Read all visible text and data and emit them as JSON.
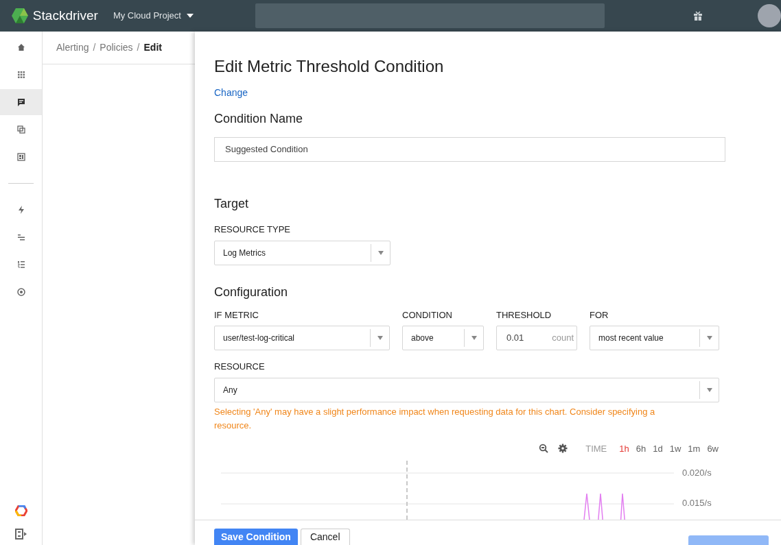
{
  "header": {
    "product": "Stackdriver",
    "project": "My Cloud Project"
  },
  "sidebar": {
    "items": [
      {
        "selected": false
      },
      {
        "selected": false
      },
      {
        "selected": true
      },
      {
        "selected": false
      },
      {
        "selected": false
      },
      {
        "selected": false
      },
      {
        "selected": false
      },
      {
        "selected": false
      },
      {
        "selected": false
      }
    ]
  },
  "breadcrumb": {
    "separator": "/",
    "items": [
      {
        "label": "Alerting",
        "current": false
      },
      {
        "label": "Policies",
        "current": false
      },
      {
        "label": "Edit",
        "current": true
      }
    ]
  },
  "panel": {
    "title": "Edit Metric Threshold Condition",
    "change_link": "Change",
    "condition_name": {
      "heading": "Condition Name",
      "value": "Suggested Condition"
    },
    "target": {
      "heading": "Target",
      "resource_type": {
        "label": "RESOURCE TYPE",
        "value": "Log Metrics"
      }
    },
    "configuration": {
      "heading": "Configuration",
      "if_metric": {
        "label": "IF METRIC",
        "value": "user/test-log-critical"
      },
      "condition": {
        "label": "CONDITION",
        "value": "above"
      },
      "threshold": {
        "label": "THRESHOLD",
        "value": "0.01",
        "unit": "count"
      },
      "for": {
        "label": "FOR",
        "value": "most recent value"
      },
      "resource": {
        "label": "RESOURCE",
        "value": "Any"
      },
      "warning": "Selecting 'Any' may have a slight performance impact when requesting data for this chart. Consider specifying a resource."
    },
    "chart": {
      "time_label": "TIME",
      "ranges": [
        {
          "label": "1h",
          "selected": true
        },
        {
          "label": "6h",
          "selected": false
        },
        {
          "label": "1d",
          "selected": false
        },
        {
          "label": "1w",
          "selected": false
        },
        {
          "label": "1m",
          "selected": false
        },
        {
          "label": "6w",
          "selected": false
        }
      ],
      "y_labels": [
        "0.020/s",
        "0.015/s"
      ]
    },
    "buttons": {
      "save": "Save Condition",
      "cancel": "Cancel"
    }
  }
}
